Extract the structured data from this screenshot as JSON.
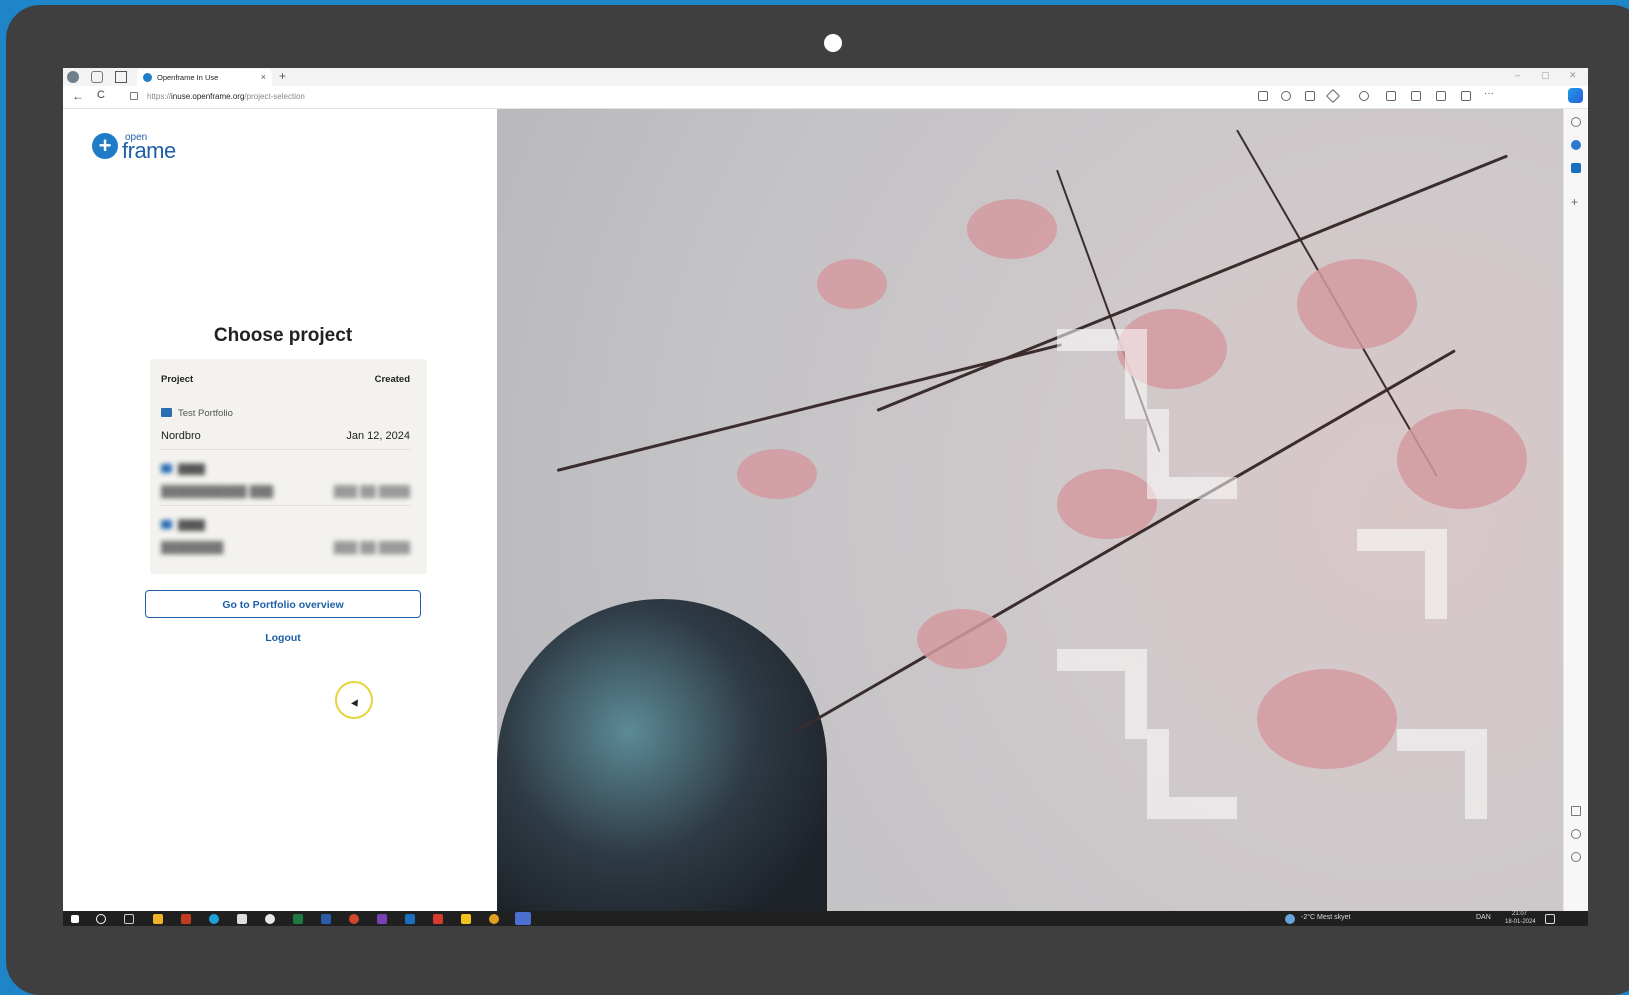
{
  "browser": {
    "tab_title": "Openframe In Use",
    "tab_close": "×",
    "new_tab": "+",
    "url_prefix": "https://",
    "url_host": "inuse.openframe.org",
    "url_path": "/project-selection",
    "back_icon": "←",
    "reload_icon": "C",
    "minimize": "–",
    "maximize": "▢",
    "close": "✕",
    "more": "···"
  },
  "logo": {
    "small": "open",
    "large": "frame"
  },
  "main": {
    "title": "Choose project",
    "table": {
      "headers": [
        "Project",
        "Created"
      ],
      "rows": [
        {
          "portfolio": "Test Portfolio",
          "name": "Nordbro",
          "date": "Jan 12, 2024"
        },
        {
          "portfolio": "████",
          "name": "███████████ ███",
          "date": "███ ██ ████"
        },
        {
          "portfolio": "████",
          "name": "████████",
          "date": "███ ██ ████"
        }
      ]
    },
    "portfolio_button": "Go to Portfolio overview",
    "logout": "Logout"
  },
  "taskbar": {
    "weather": "-2°C  Mest skyet",
    "lang": "DAN",
    "time": "21:07",
    "date": "18-01-2024"
  },
  "colors": {
    "accent": "#1e5fa8",
    "brand_blue": "#1e7cc8",
    "frame_bg": "#1e86c8",
    "device": "#3f3f3f"
  }
}
